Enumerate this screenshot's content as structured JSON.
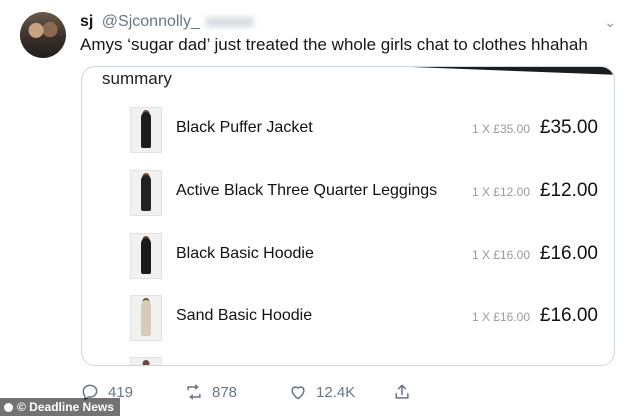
{
  "tweet": {
    "display_name": "sj",
    "handle": "@Sjconnolly_",
    "text": "Amys ‘sugar dad’ just treated the whole girls chat to clothes hhahah"
  },
  "card": {
    "title": "summary",
    "items": [
      {
        "name": "Black Puffer Jacket",
        "qty": "1 X £35.00",
        "price": "£35.00",
        "outfit_color": "#1d1d1d"
      },
      {
        "name": "Active Black Three Quarter Leggings",
        "qty": "1 X £12.00",
        "price": "£12.00",
        "outfit_color": "#222222"
      },
      {
        "name": "Black Basic Hoodie",
        "qty": "1 X £16.00",
        "price": "£16.00",
        "outfit_color": "#1a1a1a"
      },
      {
        "name": "Sand Basic Hoodie",
        "qty": "1 X £16.00",
        "price": "£16.00",
        "outfit_color": "#d8ccb8"
      }
    ]
  },
  "actions": {
    "reply_count": "419",
    "retweet_count": "878",
    "like_count": "12.4K"
  },
  "watermark": "© Deadline News"
}
